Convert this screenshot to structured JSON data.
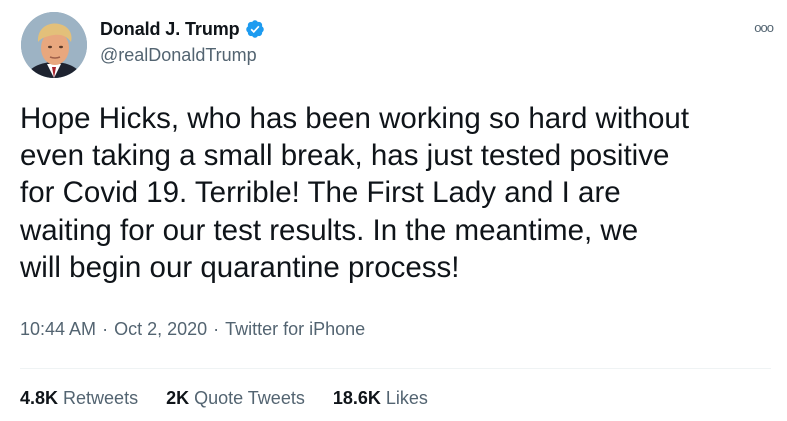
{
  "user": {
    "display_name": "Donald J. Trump",
    "handle": "@realDonaldTrump",
    "verified_icon": "verified-badge-icon",
    "avatar_icon": "profile-photo"
  },
  "menu": {
    "more_glyph": "ooo"
  },
  "tweet": {
    "lines": [
      "Hope Hicks, who has been working so hard without",
      "even taking a small break, has just tested positive",
      "for Covid 19. Terrible! The First Lady and I are",
      "waiting for our test results. In the meantime, we",
      "will begin our quarantine process!"
    ],
    "time": "10:44 AM",
    "date": "Oct 2, 2020",
    "source": "Twitter for iPhone",
    "separator": "·"
  },
  "stats": {
    "retweets": {
      "count": "4.8K",
      "label": "Retweets"
    },
    "quotes": {
      "count": "2K",
      "label": "Quote Tweets"
    },
    "likes": {
      "count": "18.6K",
      "label": "Likes"
    }
  },
  "colors": {
    "accent": "#1d9bf0",
    "text_primary": "#0f1419",
    "text_secondary": "#536471"
  }
}
